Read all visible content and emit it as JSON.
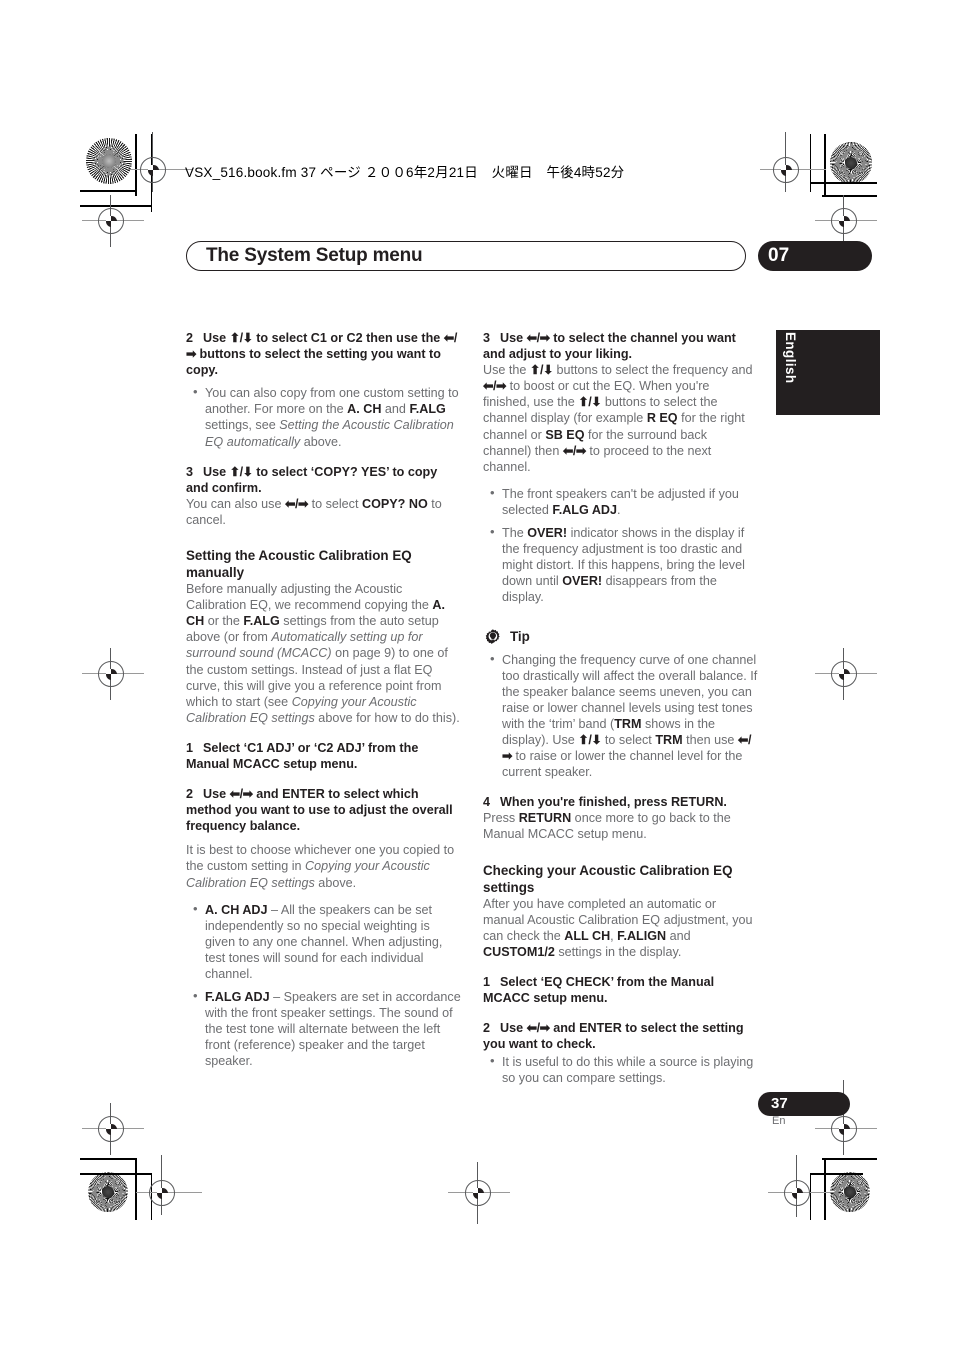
{
  "print_marks": {
    "file_line": "VSX_516.book.fm 37 ページ  ２００6年2月21日　火曜日　午後4時52分"
  },
  "header": {
    "title": "The System Setup menu",
    "chapter": "07"
  },
  "side_tab": {
    "language": "English"
  },
  "footer": {
    "page_number": "37",
    "language_code": "En"
  },
  "left_column": {
    "step2": {
      "num": "2",
      "heading_html": "Use <span class=\"arrow\">⬆/⬇</span> to select C1 or C2 then use the <span class=\"arrow\">⬅/➡</span> buttons to select the setting you want to copy.",
      "bullets": [
        "You can also copy from one custom setting to another. For more on the <b>A. CH</b> and <b>F.ALG</b> settings, see <i>Setting the Acoustic Calibration EQ automatically</i> above."
      ]
    },
    "step3": {
      "num": "3",
      "heading_html": "Use <span class=\"arrow\">⬆/⬇</span> to select ‘COPY? YES’ to copy and confirm.",
      "body_html": "You can also use <span class=\"arrow\">⬅/➡</span> to select <b>COPY? NO</b> to cancel."
    },
    "section_manual": {
      "heading": "Setting the Acoustic Calibration EQ manually",
      "body_html": "Before manually adjusting the Acoustic Calibration EQ, we recommend copying the <b>A. CH</b> or the <b>F.ALG</b> settings from the auto setup above (or from <i>Automatically setting up for surround sound (MCACC)</i> on page 9) to one of the custom settings. Instead of just a flat EQ curve, this will give you a reference point from which to start (see <i>Copying your Acoustic Calibration EQ settings</i> above for how to do this)."
    },
    "step1b": {
      "num": "1",
      "heading_html": "Select ‘C1 ADJ’ or ‘C2 ADJ’ from the Manual MCACC setup menu."
    },
    "step2b": {
      "num": "2",
      "heading_html": "Use <span class=\"arrow\">⬅/➡</span> and ENTER to select which method you want to use to adjust the overall frequency balance.",
      "body_html": "It is best to choose whichever one you copied to the custom setting in <i>Copying your Acoustic Calibration EQ settings</i> above.",
      "bullets": [
        "<b>A. CH ADJ</b> – All the speakers can be set independently so no special weighting is given to any one channel. When adjusting, test tones will sound for each individual channel.",
        "<b>F.ALG ADJ</b> – Speakers are set in accordance with the front speaker settings. The sound of the test tone will alternate between the left front (reference) speaker and the target speaker."
      ]
    }
  },
  "right_column": {
    "step3": {
      "num": "3",
      "heading_html": "Use <span class=\"arrow\">⬅/➡</span> to select the channel you want and adjust to your liking.",
      "body_html": "Use the <span class=\"arrow\">⬆/⬇</span> buttons to select the frequency and <span class=\"arrow\">⬅/➡</span> to boost or cut the EQ. When you're finished, use the <span class=\"arrow\">⬆/⬇</span> buttons to select the channel display (for example <b>R EQ</b> for the right channel or <b>SB EQ</b> for the surround back channel) then <span class=\"arrow\">⬅/➡</span> to proceed to the next channel.",
      "bullets": [
        "The front speakers can't be adjusted if you selected <b>F.ALG ADJ</b>.",
        "The <b>OVER!</b> indicator shows in the display if the frequency adjustment is too drastic and might distort. If this happens, bring the level down until <b>OVER!</b> disappears from the display."
      ]
    },
    "tip": {
      "icon": "gear-lightbulb-icon",
      "label": "Tip",
      "bullets": [
        "Changing the frequency curve of one channel too drastically will affect the overall balance. If the speaker balance seems uneven, you can raise or lower channel levels using test tones with the ‘trim’ band (<b>TRM</b> shows in the display). Use <span class=\"arrow\">⬆/⬇</span> to select <b>TRM</b> then use <span class=\"arrow\">⬅/➡</span> to raise or lower the channel level for the current speaker."
      ]
    },
    "step4": {
      "num": "4",
      "heading_html": "When you're finished, press RETURN.",
      "body_html": "Press <b>RETURN</b> once more to go back to the Manual MCACC setup menu."
    },
    "section_checking": {
      "heading": "Checking your Acoustic Calibration EQ settings",
      "body_html": "After you have completed an automatic or manual Acoustic Calibration EQ adjustment, you can check the <b>ALL CH</b>, <b>F.ALIGN</b> and <b>CUSTOM1/2</b> settings in the display."
    },
    "step1c": {
      "num": "1",
      "heading_html": "Select ‘EQ CHECK’ from the Manual MCACC setup menu."
    },
    "step2c": {
      "num": "2",
      "heading_html": "Use <span class=\"arrow\">⬅/➡</span> and ENTER to select the setting you want to check.",
      "bullets": [
        "It is useful to do this while a source is playing so you can compare settings."
      ]
    }
  },
  "colors": {
    "ink": "#231f20",
    "body_gray": "#6d6e71",
    "mark_gray": "#58595b"
  }
}
